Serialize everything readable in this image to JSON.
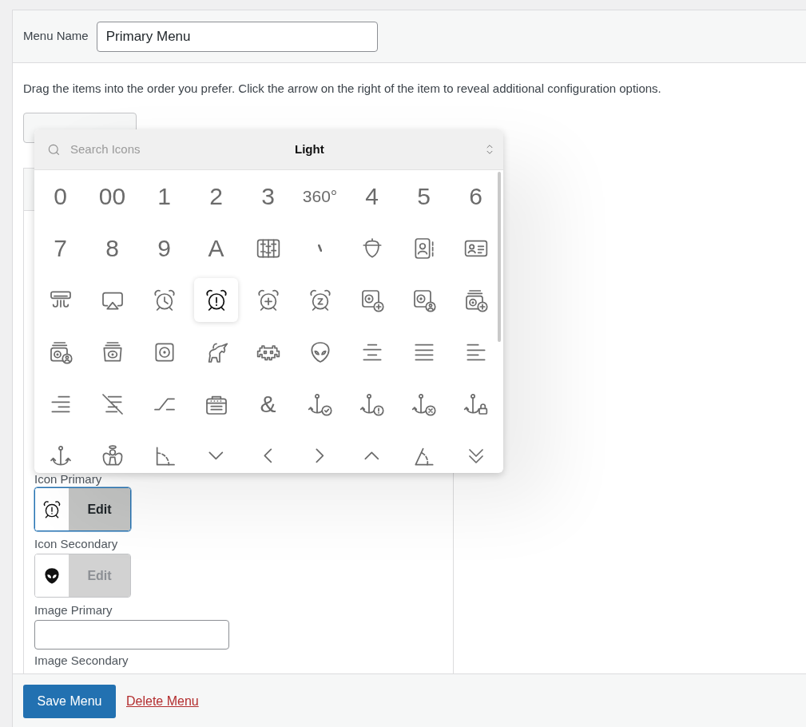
{
  "menu_name": {
    "label": "Menu Name",
    "value": "Primary Menu"
  },
  "instructions": "Drag the items into the order you prefer. Click the arrow on the right of the item to reveal additional configuration options.",
  "icon_picker": {
    "search": {
      "placeholder": "Search Icons"
    },
    "style": "Light",
    "items": [
      {
        "kind": "glyph",
        "text": "0",
        "selected": false
      },
      {
        "kind": "glyph",
        "text": "00",
        "selected": false
      },
      {
        "kind": "glyph",
        "text": "1",
        "selected": false
      },
      {
        "kind": "glyph",
        "text": "2",
        "selected": false
      },
      {
        "kind": "glyph",
        "text": "3",
        "selected": false
      },
      {
        "kind": "glyph",
        "text": "360°",
        "selected": false
      },
      {
        "kind": "glyph",
        "text": "4",
        "selected": false
      },
      {
        "kind": "glyph",
        "text": "5",
        "selected": false
      },
      {
        "kind": "glyph",
        "text": "6",
        "selected": false
      },
      {
        "kind": "glyph",
        "text": "7",
        "selected": false
      },
      {
        "kind": "glyph",
        "text": "8",
        "selected": false
      },
      {
        "kind": "glyph",
        "text": "9",
        "selected": false
      },
      {
        "kind": "glyph",
        "text": "A",
        "selected": false
      },
      {
        "kind": "icon",
        "selected": false
      },
      {
        "kind": "icon",
        "selected": false
      },
      {
        "kind": "icon",
        "selected": false
      },
      {
        "kind": "icon",
        "selected": false
      },
      {
        "kind": "icon",
        "selected": false
      },
      {
        "kind": "icon",
        "selected": false
      },
      {
        "kind": "icon",
        "selected": false
      },
      {
        "kind": "icon",
        "selected": false
      },
      {
        "kind": "icon",
        "selected": true
      },
      {
        "kind": "icon",
        "selected": false
      },
      {
        "kind": "icon",
        "selected": false
      },
      {
        "kind": "icon",
        "selected": false
      },
      {
        "kind": "icon",
        "selected": false
      },
      {
        "kind": "icon",
        "selected": false
      },
      {
        "kind": "icon",
        "selected": false
      },
      {
        "kind": "icon",
        "selected": false
      },
      {
        "kind": "icon",
        "selected": false
      },
      {
        "kind": "icon",
        "selected": false
      },
      {
        "kind": "icon",
        "selected": false
      },
      {
        "kind": "icon",
        "selected": false
      },
      {
        "kind": "icon",
        "selected": false
      },
      {
        "kind": "icon",
        "selected": false
      },
      {
        "kind": "icon",
        "selected": false
      },
      {
        "kind": "icon",
        "selected": false
      },
      {
        "kind": "icon",
        "selected": false
      },
      {
        "kind": "icon",
        "selected": false
      },
      {
        "kind": "icon",
        "selected": false
      },
      {
        "kind": "glyph",
        "text": "&",
        "selected": false
      },
      {
        "kind": "icon",
        "selected": false
      },
      {
        "kind": "icon",
        "selected": false
      },
      {
        "kind": "icon",
        "selected": false
      },
      {
        "kind": "icon",
        "selected": false
      },
      {
        "kind": "icon",
        "selected": false
      },
      {
        "kind": "icon",
        "selected": false
      },
      {
        "kind": "icon",
        "selected": false
      },
      {
        "kind": "icon",
        "selected": false
      },
      {
        "kind": "icon",
        "selected": false
      },
      {
        "kind": "icon",
        "selected": false
      },
      {
        "kind": "icon",
        "selected": false
      },
      {
        "kind": "icon",
        "selected": false
      },
      {
        "kind": "icon",
        "selected": false
      }
    ]
  },
  "fields": [
    {
      "kind": "icon",
      "label": "Icon Primary",
      "focused": true,
      "button": "Edit",
      "disabled": false
    },
    {
      "kind": "icon",
      "label": "Icon Secondary",
      "focused": false,
      "button": "Edit",
      "disabled": true
    },
    {
      "kind": "text",
      "label": "Image Primary"
    },
    {
      "kind": "label",
      "label": "Image Secondary"
    }
  ],
  "footer": {
    "save": "Save Menu",
    "delete": "Delete Menu"
  }
}
